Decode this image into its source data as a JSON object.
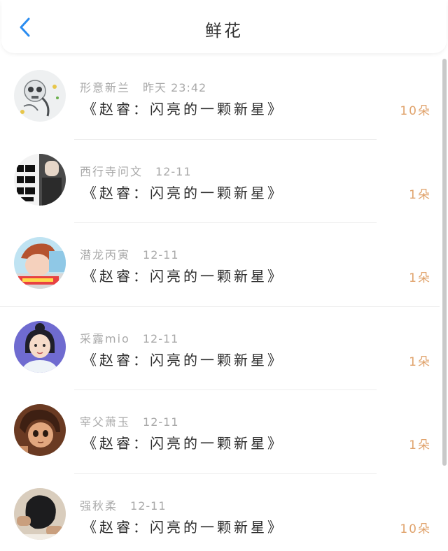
{
  "header": {
    "back_icon": "chevron-left-icon",
    "title": "鲜花",
    "accent_color": "#2a8cf0"
  },
  "colors": {
    "count": "#e0a36c",
    "meta": "#a9a9a9",
    "book": "#2c2c2c"
  },
  "list": {
    "items": [
      {
        "user": "形意新兰",
        "time": "昨天 23:42",
        "book": "《赵睿：闪亮的一颗新星》",
        "count": "10朵",
        "avatar": "skull-figure-avatar"
      },
      {
        "user": "西行寺问文",
        "time": "12-11",
        "book": "《赵睿：闪亮的一颗新星》",
        "count": "1朵",
        "avatar": "text-photo-avatar"
      },
      {
        "user": "潜龙丙寅",
        "time": "12-11",
        "book": "《赵睿：闪亮的一颗新星》",
        "count": "1朵",
        "avatar": "anime-boy-avatar"
      },
      {
        "user": "采露mio",
        "time": "12-11",
        "book": "《赵睿：闪亮的一颗新星》",
        "count": "1朵",
        "avatar": "girl-portrait-avatar"
      },
      {
        "user": "宰父萧玉",
        "time": "12-11",
        "book": "《赵睿：闪亮的一颗新星》",
        "count": "1朵",
        "avatar": "anime-character-avatar"
      },
      {
        "user": "强秋柔",
        "time": "12-11",
        "book": "《赵睿：闪亮的一颗新星》",
        "count": "10朵",
        "avatar": "dark-figure-avatar"
      }
    ]
  }
}
